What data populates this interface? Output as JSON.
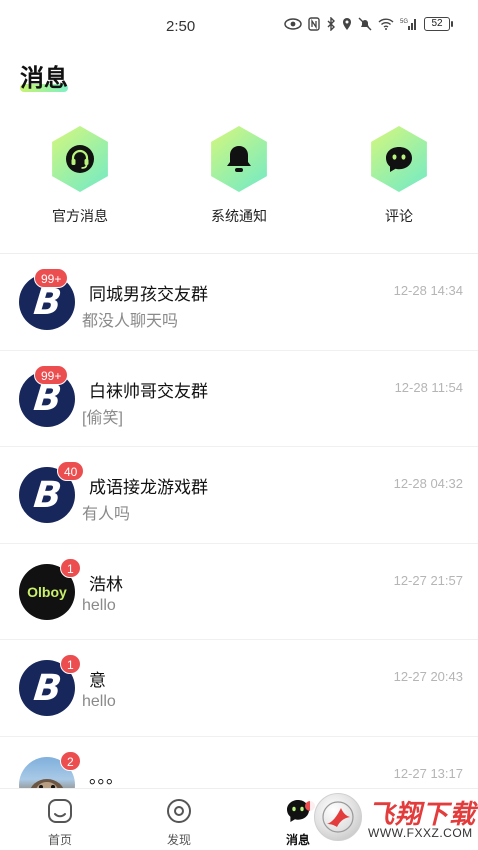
{
  "status_bar": {
    "time": "2:50",
    "network": "5G",
    "battery": "52"
  },
  "header": {
    "title": "消息"
  },
  "quick_actions": [
    {
      "label": "官方消息",
      "icon": "headset-icon"
    },
    {
      "label": "系统通知",
      "icon": "bell-icon"
    },
    {
      "label": "评论",
      "icon": "chat-bubble-icon"
    }
  ],
  "conversations": [
    {
      "name": "同城男孩交友群",
      "preview": "都没人聊天吗",
      "time": "12-28 14:34",
      "badge": "99+",
      "avatar": "B"
    },
    {
      "name": "白袜帅哥交友群",
      "preview": "[偷笑]",
      "time": "12-28 11:54",
      "badge": "99+",
      "avatar": "B"
    },
    {
      "name": "成语接龙游戏群",
      "preview": "有人吗",
      "time": "12-28 04:32",
      "badge": "40",
      "avatar": "B"
    },
    {
      "name": "浩林",
      "preview": "hello",
      "time": "12-27 21:57",
      "badge": "1",
      "avatar": "Olboy"
    },
    {
      "name": "意",
      "preview": "hello",
      "time": "12-27 20:43",
      "badge": "1",
      "avatar": "B"
    },
    {
      "name": "。。。",
      "preview": "",
      "time": "12-27 13:17",
      "badge": "2",
      "avatar": "otter-photo"
    }
  ],
  "tabs": [
    {
      "label": "首页",
      "icon": "home-icon"
    },
    {
      "label": "发现",
      "icon": "discover-icon"
    },
    {
      "label": "消息",
      "icon": "message-icon",
      "active": true
    }
  ],
  "watermark": {
    "title": "飞翔下载",
    "url": "WWW.FXXZ.COM"
  },
  "colors": {
    "accent_gradient_start": "#d9f77a",
    "accent_gradient_end": "#6fe9c9",
    "badge": "#ec4e50",
    "group_avatar": "#17275c"
  }
}
